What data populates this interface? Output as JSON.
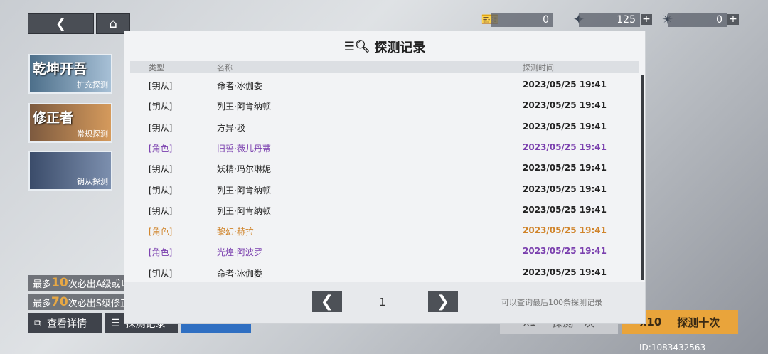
{
  "top_right": {
    "res1_value": "0",
    "res2_value": "125",
    "res3_value": "0",
    "plus": "+"
  },
  "nav": {
    "back_icon": "❮",
    "home_icon": "⌂"
  },
  "banners": [
    {
      "title": "乾坤开吾",
      "subtitle": "扩充探测"
    },
    {
      "title": "修正者",
      "subtitle": "常规探测"
    },
    {
      "title": "",
      "subtitle": "钥从探测"
    }
  ],
  "info_lines": [
    {
      "prefix": "最多",
      "num": "10",
      "suffix": "次必出A级或以"
    },
    {
      "prefix": "最多",
      "num": "70",
      "suffix": "次必出S级修正"
    }
  ],
  "bottom_left": {
    "details_label": "查看详情",
    "records_label": "探测记录"
  },
  "bottom_right": {
    "ten_count": "x10",
    "ten_label": "探测十次",
    "one_count": "x1",
    "one_label": "探测一次"
  },
  "player_id": "ID:1083432563",
  "modal": {
    "title": "探测记录",
    "headers": {
      "type": "类型",
      "name": "名称",
      "time": "探测时间"
    },
    "rows": [
      {
        "type": "[钥从]",
        "name": "命者·冰伽娄",
        "time": "2023/05/25 19:41",
        "tone": ""
      },
      {
        "type": "[钥从]",
        "name": "列王·阿肯纳顿",
        "time": "2023/05/25 19:41",
        "tone": ""
      },
      {
        "type": "[钥从]",
        "name": "方异·驳",
        "time": "2023/05/25 19:41",
        "tone": ""
      },
      {
        "type": "[角色]",
        "name": "旧誓·薇儿丹蒂",
        "time": "2023/05/25 19:41",
        "tone": "purple"
      },
      {
        "type": "[钥从]",
        "name": "妖精·玛尔琳妮",
        "time": "2023/05/25 19:41",
        "tone": ""
      },
      {
        "type": "[钥从]",
        "name": "列王·阿肯纳顿",
        "time": "2023/05/25 19:41",
        "tone": ""
      },
      {
        "type": "[钥从]",
        "name": "列王·阿肯纳顿",
        "time": "2023/05/25 19:41",
        "tone": ""
      },
      {
        "type": "[角色]",
        "name": "黎幻·赫拉",
        "time": "2023/05/25 19:41",
        "tone": "orange"
      },
      {
        "type": "[角色]",
        "name": "光煌·阿波罗",
        "time": "2023/05/25 19:41",
        "tone": "purple"
      },
      {
        "type": "[钥从]",
        "name": "命者·冰伽娄",
        "time": "2023/05/25 19:41",
        "tone": ""
      }
    ],
    "page": "1",
    "prev_icon": "❮",
    "next_icon": "❯",
    "note": "可以查询最后100条探测记录"
  },
  "colors": {
    "purple": "#7a3fae",
    "orange": "#d0842a"
  }
}
